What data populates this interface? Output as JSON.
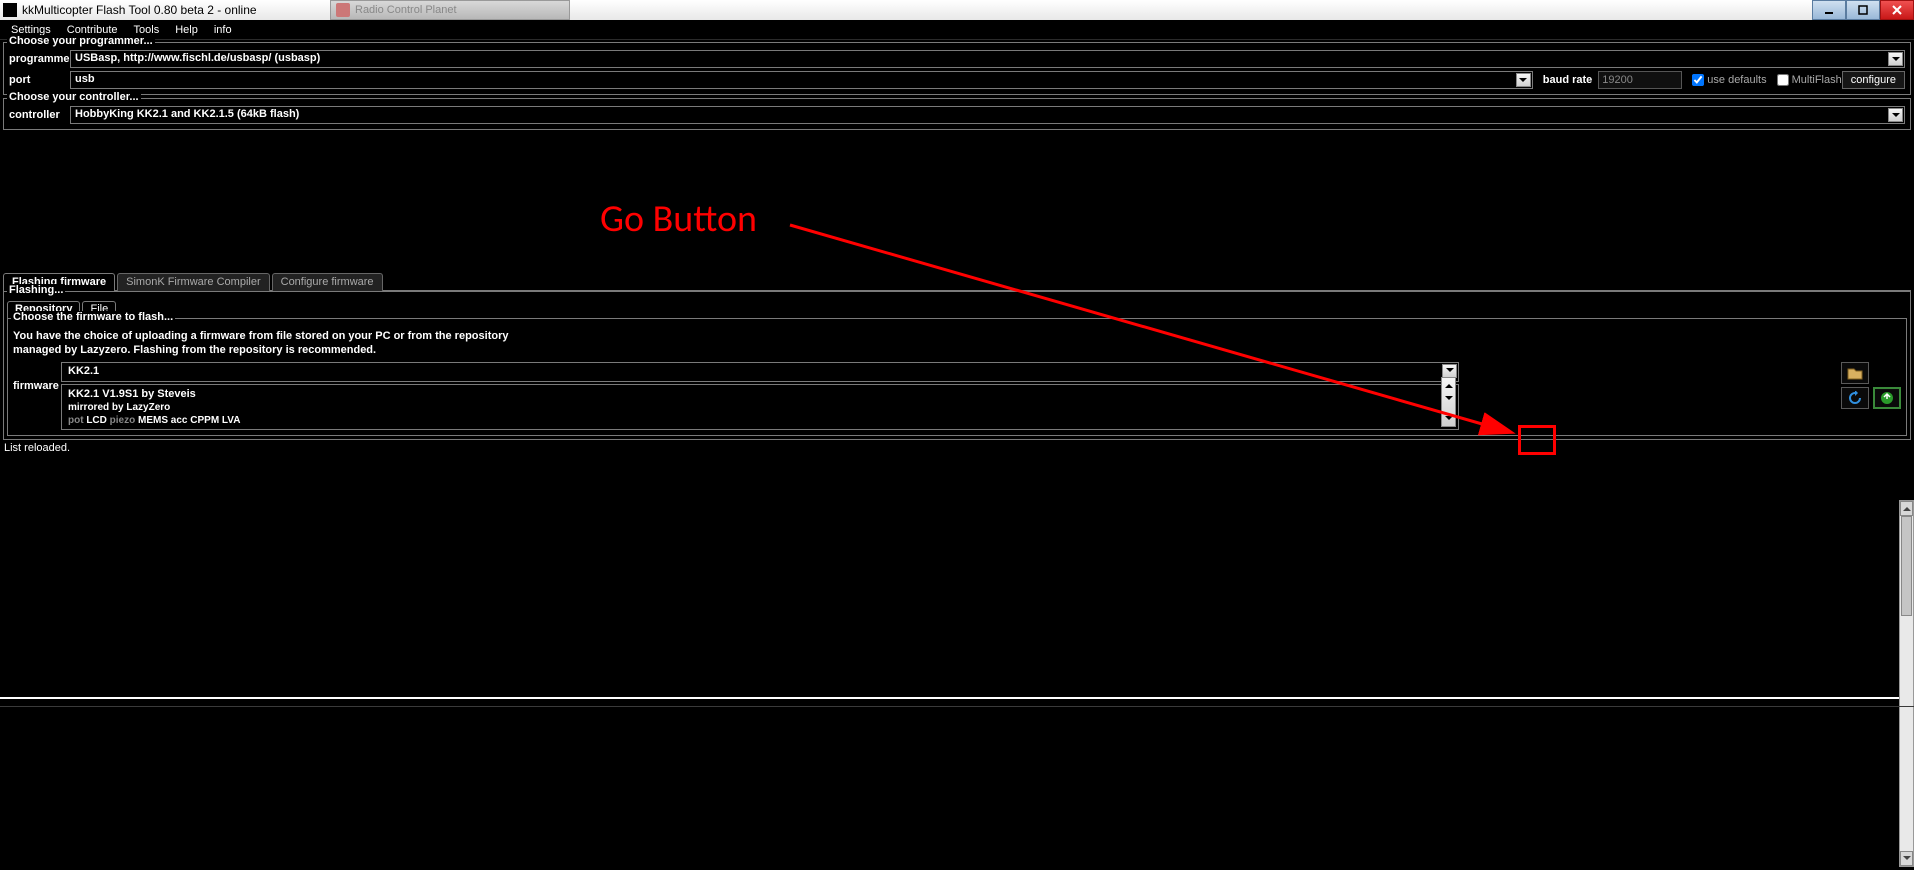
{
  "titlebar": {
    "title": "kkMulticopter Flash Tool 0.80 beta 2 - online",
    "background_tab": "Radio Control Planet"
  },
  "menu": {
    "settings": "Settings",
    "contribute": "Contribute",
    "tools": "Tools",
    "help": "Help",
    "info": "info"
  },
  "programmer_group": {
    "legend": "Choose your programmer...",
    "programmer_label": "programmer",
    "programmer_value": "USBasp, http://www.fischl.de/usbasp/ (usbasp)",
    "port_label": "port",
    "port_value": "usb",
    "baud_label": "baud rate",
    "baud_value": "19200",
    "use_defaults": "use defaults",
    "multiflash": "MultiFlash",
    "configure": "configure"
  },
  "controller_group": {
    "legend": "Choose your controller...",
    "controller_label": "controller",
    "controller_value": "HobbyKing KK2.1 and KK2.1.5 (64kB flash)"
  },
  "tabs": {
    "flashing": "Flashing firmware",
    "simonk": "SimonK Firmware Compiler",
    "configure": "Configure firmware"
  },
  "flashing": {
    "legend": "Flashing...",
    "tab_repo": "Repository",
    "tab_file": "File",
    "fw_legend": "Choose the firmware to flash...",
    "desc1": "You have the choice of uploading a firmware from file stored on your PC or from the repository",
    "desc2": "managed by Lazyzero. Flashing from the repository is recommended.",
    "fw_label": "firmware",
    "fw_category": "KK2.1",
    "fw_title": "KK2.1 V1.9S1  by Steveis",
    "fw_mirror": "mirrored by LazyZero",
    "fw_tags_off1": "pot",
    "fw_tags_on1": "LCD",
    "fw_tags_off2": "piezo",
    "fw_tags_on2": "MEMS  acc  CPPM  LVA"
  },
  "status": "List reloaded.",
  "annotation": "Go Button"
}
